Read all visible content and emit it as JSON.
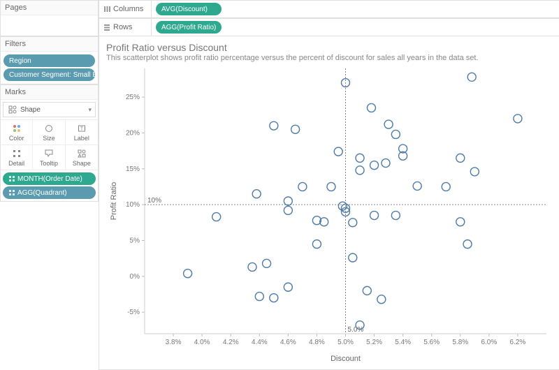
{
  "panels": {
    "pages": "Pages",
    "filters": "Filters",
    "marks": "Marks"
  },
  "filter_pills": [
    "Region",
    "Customer Segment: Small Busin..."
  ],
  "marks_shape_select": "Shape",
  "marks_cards": {
    "color": "Color",
    "size": "Size",
    "label": "Label",
    "detail": "Detail",
    "tooltip": "Tooltip",
    "shape": "Shape"
  },
  "marks_pills": [
    {
      "label": "MONTH(Order Date)",
      "color": "teal"
    },
    {
      "label": "AGG(Quadrant)",
      "color": "blue"
    }
  ],
  "shelves": {
    "columns_label": "Columns",
    "rows_label": "Rows",
    "columns_pill": "AVG(Discount)",
    "rows_pill": "AGG(Profit Ratio)"
  },
  "chart": {
    "title": "Profit Ratio versus Discount",
    "subtitle": "This scatterplot shows profit ratio percentage versus the percent of discount for sales all years in the data set.",
    "xlabel": "Discount",
    "ylabel": "Profit Ratio"
  },
  "chart_data": {
    "type": "scatter",
    "xlabel": "Discount",
    "ylabel": "Profit Ratio",
    "xlim": [
      0.036,
      0.064
    ],
    "ylim": [
      -0.08,
      0.29
    ],
    "x_ticks": [
      "3.8%",
      "4.0%",
      "4.2%",
      "4.4%",
      "4.6%",
      "4.8%",
      "5.0%",
      "5.2%",
      "5.4%",
      "5.6%",
      "5.8%",
      "6.0%",
      "6.2%"
    ],
    "y_ticks": [
      "-5%",
      "0%",
      "5%",
      "10%",
      "15%",
      "20%",
      "25%"
    ],
    "ref_x": {
      "value": 0.05,
      "label": "5.0%"
    },
    "ref_y": {
      "value": 0.1,
      "label": "10%"
    },
    "points": [
      {
        "x": 0.039,
        "y": 0.004
      },
      {
        "x": 0.041,
        "y": 0.083
      },
      {
        "x": 0.0435,
        "y": 0.013
      },
      {
        "x": 0.0438,
        "y": 0.115
      },
      {
        "x": 0.044,
        "y": -0.028
      },
      {
        "x": 0.0445,
        "y": 0.018
      },
      {
        "x": 0.045,
        "y": -0.03
      },
      {
        "x": 0.045,
        "y": 0.21
      },
      {
        "x": 0.046,
        "y": 0.105
      },
      {
        "x": 0.046,
        "y": 0.092
      },
      {
        "x": 0.046,
        "y": -0.015
      },
      {
        "x": 0.0465,
        "y": 0.205
      },
      {
        "x": 0.047,
        "y": 0.125
      },
      {
        "x": 0.048,
        "y": 0.045
      },
      {
        "x": 0.048,
        "y": 0.078
      },
      {
        "x": 0.0485,
        "y": 0.076
      },
      {
        "x": 0.049,
        "y": 0.125
      },
      {
        "x": 0.0495,
        "y": 0.174
      },
      {
        "x": 0.0498,
        "y": 0.098
      },
      {
        "x": 0.05,
        "y": 0.09
      },
      {
        "x": 0.05,
        "y": 0.095
      },
      {
        "x": 0.05,
        "y": 0.27
      },
      {
        "x": 0.0505,
        "y": 0.075
      },
      {
        "x": 0.0505,
        "y": 0.026
      },
      {
        "x": 0.051,
        "y": -0.068
      },
      {
        "x": 0.051,
        "y": 0.165
      },
      {
        "x": 0.051,
        "y": 0.148
      },
      {
        "x": 0.0515,
        "y": -0.02
      },
      {
        "x": 0.0518,
        "y": 0.235
      },
      {
        "x": 0.052,
        "y": 0.155
      },
      {
        "x": 0.052,
        "y": 0.085
      },
      {
        "x": 0.0525,
        "y": -0.032
      },
      {
        "x": 0.0528,
        "y": 0.158
      },
      {
        "x": 0.053,
        "y": 0.212
      },
      {
        "x": 0.0535,
        "y": 0.085
      },
      {
        "x": 0.0535,
        "y": 0.198
      },
      {
        "x": 0.054,
        "y": 0.178
      },
      {
        "x": 0.054,
        "y": 0.168
      },
      {
        "x": 0.055,
        "y": 0.126
      },
      {
        "x": 0.057,
        "y": 0.125
      },
      {
        "x": 0.058,
        "y": 0.076
      },
      {
        "x": 0.058,
        "y": 0.165
      },
      {
        "x": 0.0585,
        "y": 0.045
      },
      {
        "x": 0.0588,
        "y": 0.278
      },
      {
        "x": 0.059,
        "y": 0.146
      },
      {
        "x": 0.062,
        "y": 0.22
      }
    ]
  }
}
